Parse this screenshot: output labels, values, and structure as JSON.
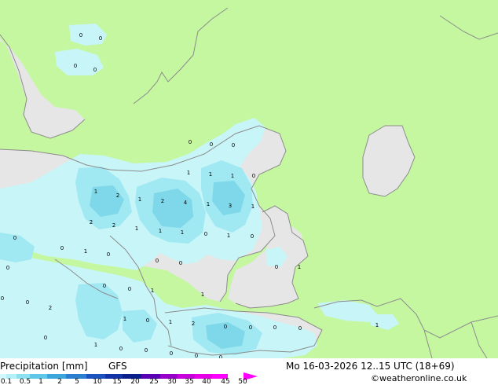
{
  "title": "Precipitation [mm]",
  "model": "GFS",
  "datetime": "Mo 16-03-2026 12..15 UTC (18+69)",
  "credit": "©weatheronline.co.uk",
  "colors": {
    "land": "#c4f7a0",
    "sea": "#e6e6e6",
    "coast": "#8c8c8c",
    "precip_light": "#c8f5f8",
    "precip_mid": "#a0e8f2",
    "precip_heavy": "#7fd8ea"
  },
  "legend": {
    "ticks": [
      "0.1",
      "0.5",
      "1",
      "2",
      "5",
      "10",
      "15",
      "20",
      "25",
      "30",
      "35",
      "40",
      "45",
      "50"
    ],
    "swatch_colors": [
      "#d2f8fb",
      "#b4f0f7",
      "#8ce0f0",
      "#5fc8e8",
      "#3aa6dc",
      "#2a7fd0",
      "#1c52c0",
      "#1233a8",
      "#0a1e8c",
      "#5a00b4",
      "#9600c8",
      "#c800dc",
      "#e600e6",
      "#ff00ff"
    ]
  },
  "value_labels": [
    "0",
    "0",
    "0",
    "0",
    "0",
    "0",
    "0",
    "1",
    "1",
    "1",
    "0",
    "1",
    "2",
    "1",
    "2",
    "4",
    "1",
    "3",
    "1",
    "2",
    "2",
    "1",
    "1",
    "1",
    "0",
    "1",
    "0",
    "0",
    "0",
    "1",
    "0",
    "0",
    "0",
    "0",
    "0",
    "1",
    "0",
    "0",
    "1",
    "1",
    "0",
    "0",
    "2",
    "1",
    "0",
    "1",
    "2",
    "0",
    "0",
    "0",
    "0",
    "1",
    "0",
    "1",
    "0",
    "0",
    "0",
    "0",
    "0"
  ]
}
